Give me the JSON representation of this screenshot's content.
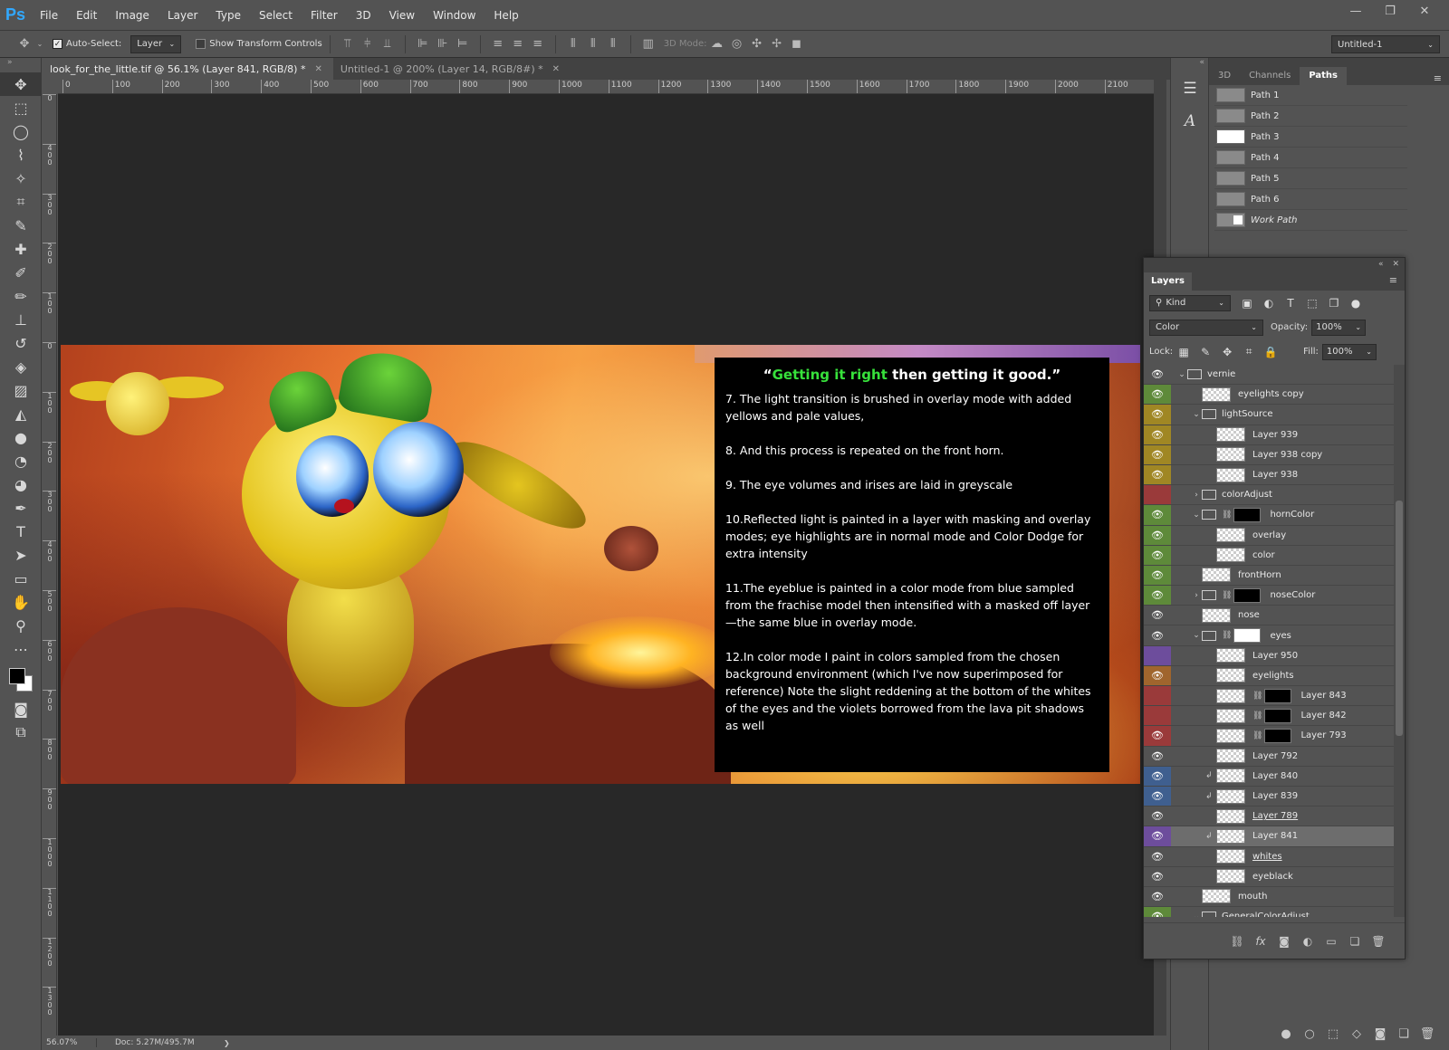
{
  "app": {
    "logo": "Ps"
  },
  "menu": [
    "File",
    "Edit",
    "Image",
    "Layer",
    "Type",
    "Select",
    "Filter",
    "3D",
    "View",
    "Window",
    "Help"
  ],
  "window_controls": {
    "minimize": "—",
    "restore": "❐",
    "close": "✕"
  },
  "options_bar": {
    "auto_select_label": "Auto-Select:",
    "auto_select_target": "Layer",
    "show_transform_label": "Show Transform Controls",
    "mode_3d_label": "3D Mode:",
    "workspace": "Untitled-1"
  },
  "doc_tabs": [
    {
      "label": "look_for_the_little.tif @ 56.1% (Layer 841, RGB/8) *",
      "close": "✕"
    },
    {
      "label": "Untitled-1 @ 200% (Layer 14, RGB/8#) *",
      "close": "✕"
    }
  ],
  "ruler_h": [
    "0",
    "100",
    "200",
    "300",
    "400",
    "500",
    "600",
    "700",
    "800",
    "900",
    "1000",
    "1100",
    "1200",
    "1300",
    "1400",
    "1500",
    "1600",
    "1700",
    "1800",
    "1900",
    "2000",
    "2100"
  ],
  "ruler_v": [
    "0",
    "4\n0\n0",
    "3\n0\n0",
    "2\n0\n0",
    "1\n0\n0",
    "0",
    "1\n0\n0",
    "2\n0\n0",
    "3\n0\n0",
    "4\n0\n0",
    "5\n0\n0",
    "6\n0\n0",
    "7\n0\n0",
    "8\n0\n0",
    "9\n0\n0",
    "1\n0\n0\n0",
    "1\n1\n0\n0",
    "1\n2\n0\n0",
    "1\n3\n0\n0"
  ],
  "artwork_text": {
    "title_quote_open": "“",
    "title_green": "Getting it right",
    "title_rest": " then getting it good.”",
    "paragraphs": [
      "7.  The light transition is brushed in overlay mode with added yellows and pale values,",
      "8.  And this process is repeated on the front horn.",
      "9.  The eye volumes and irises are laid in greyscale",
      "10.Reflected light is painted in a layer with masking and overlay modes; eye highlights are in normal mode and Color Dodge for extra intensity",
      "11.The eyeblue is painted in a color mode from blue sampled from the frachise model then intensified with a masked off layer—the same blue in overlay mode.",
      "12.In color mode I paint in colors sampled from the chosen background environment (which I've now superimposed for reference) Note the slight reddening at the bottom of the whites of the eyes and the violets borrowed from the lava pit shadows as well"
    ]
  },
  "status": {
    "zoom": "56.07%",
    "doc": "Doc: 5.27M/495.7M",
    "arrow": "❯"
  },
  "paths_panel": {
    "tabs": [
      "3D",
      "Channels",
      "Paths"
    ],
    "active_tab": "Paths",
    "paths": [
      {
        "name": "Path 1"
      },
      {
        "name": "Path 2"
      },
      {
        "name": "Path 3"
      },
      {
        "name": "Path 4"
      },
      {
        "name": "Path 5"
      },
      {
        "name": "Path 6"
      },
      {
        "name": "Work Path"
      }
    ]
  },
  "layers_panel": {
    "tab": "Layers",
    "filter_kind": "Kind",
    "blend_mode": "Color",
    "opacity_label": "Opacity:",
    "opacity": "100%",
    "lock_label": "Lock:",
    "fill_label": "Fill:",
    "fill": "100%",
    "layers": [
      {
        "name": "vernie",
        "indent": 0,
        "type": "group",
        "open": true,
        "color": "none"
      },
      {
        "name": "eyelights copy",
        "indent": 1,
        "type": "layer",
        "color": "green"
      },
      {
        "name": "lightSource",
        "indent": 1,
        "type": "group",
        "open": true,
        "color": "yellow"
      },
      {
        "name": "Layer 939",
        "indent": 2,
        "type": "layer",
        "color": "yellow"
      },
      {
        "name": "Layer 938 copy",
        "indent": 2,
        "type": "layer",
        "color": "yellow"
      },
      {
        "name": "Layer 938",
        "indent": 2,
        "type": "layer",
        "color": "yellow"
      },
      {
        "name": "colorAdjust",
        "indent": 1,
        "type": "group",
        "open": false,
        "color": "red",
        "hidden": true
      },
      {
        "name": "hornColor",
        "indent": 1,
        "type": "group",
        "open": true,
        "color": "green",
        "mask": "black"
      },
      {
        "name": "overlay",
        "indent": 2,
        "type": "layer",
        "color": "green"
      },
      {
        "name": "color",
        "indent": 2,
        "type": "layer",
        "color": "green"
      },
      {
        "name": "frontHorn",
        "indent": 1,
        "type": "layer",
        "color": "green"
      },
      {
        "name": "noseColor",
        "indent": 1,
        "type": "group",
        "open": false,
        "color": "green",
        "mask": "black"
      },
      {
        "name": "nose",
        "indent": 1,
        "type": "layer",
        "color": "none"
      },
      {
        "name": "eyes",
        "indent": 1,
        "type": "group",
        "open": true,
        "color": "none",
        "mask": "white"
      },
      {
        "name": "Layer 950",
        "indent": 2,
        "type": "layer",
        "color": "violet",
        "hidden": true
      },
      {
        "name": "eyelights",
        "indent": 2,
        "type": "layer",
        "color": "orange"
      },
      {
        "name": "Layer 843",
        "indent": 2,
        "type": "layer",
        "color": "red",
        "mask": "black",
        "hidden": true
      },
      {
        "name": "Layer 842",
        "indent": 2,
        "type": "layer",
        "color": "red",
        "mask": "black",
        "hidden": true
      },
      {
        "name": "Layer 793",
        "indent": 2,
        "type": "layer",
        "color": "red",
        "mask": "black"
      },
      {
        "name": "Layer 792",
        "indent": 2,
        "type": "layer",
        "color": "none"
      },
      {
        "name": "Layer 840",
        "indent": 2,
        "type": "layer",
        "color": "blue",
        "clip": true
      },
      {
        "name": "Layer 839",
        "indent": 2,
        "type": "layer",
        "color": "blue",
        "clip": true
      },
      {
        "name": "Layer 789",
        "indent": 2,
        "type": "layer",
        "color": "none",
        "underline": true
      },
      {
        "name": "Layer 841",
        "indent": 2,
        "type": "layer",
        "color": "violet",
        "clip": true,
        "selected": true
      },
      {
        "name": "whites",
        "indent": 2,
        "type": "layer",
        "color": "none",
        "underline": true
      },
      {
        "name": "eyeblack",
        "indent": 2,
        "type": "layer",
        "color": "none"
      },
      {
        "name": "mouth",
        "indent": 1,
        "type": "layer",
        "color": "none"
      },
      {
        "name": "GeneralColorAdjust",
        "indent": 1,
        "type": "group",
        "open": true,
        "color": "green"
      }
    ]
  },
  "colors": {
    "selection_green": "#37e13b",
    "app_bg": "#535353",
    "canvas_bg": "#282828"
  }
}
